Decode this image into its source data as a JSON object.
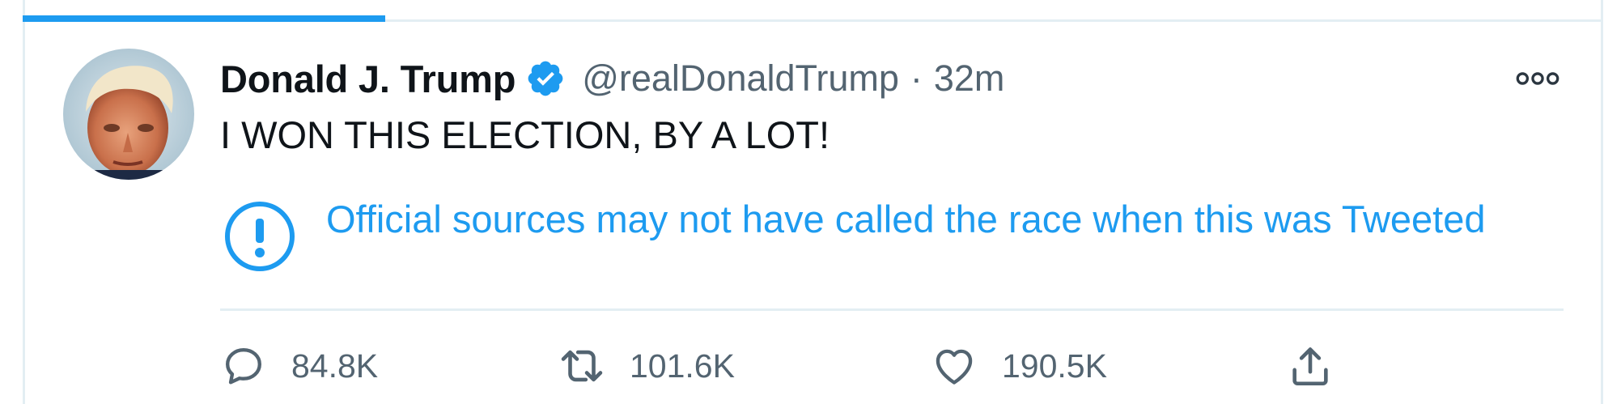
{
  "tweet": {
    "author_name": "Donald J. Trump",
    "handle": "@realDonaldTrump",
    "separator": "·",
    "timestamp": "32m",
    "text": "I WON THIS ELECTION, BY A LOT!",
    "verified": true
  },
  "notice": {
    "text": "Official sources may not have called the race when this was Tweeted",
    "icon": "exclamation-circle-icon"
  },
  "actions": {
    "reply_count": "84.8K",
    "retweet_count": "101.6K",
    "like_count": "190.5K"
  },
  "colors": {
    "accent": "#1d9bf0",
    "text": "#0f1419",
    "secondary_text": "#536471",
    "divider": "#e3eef3"
  }
}
